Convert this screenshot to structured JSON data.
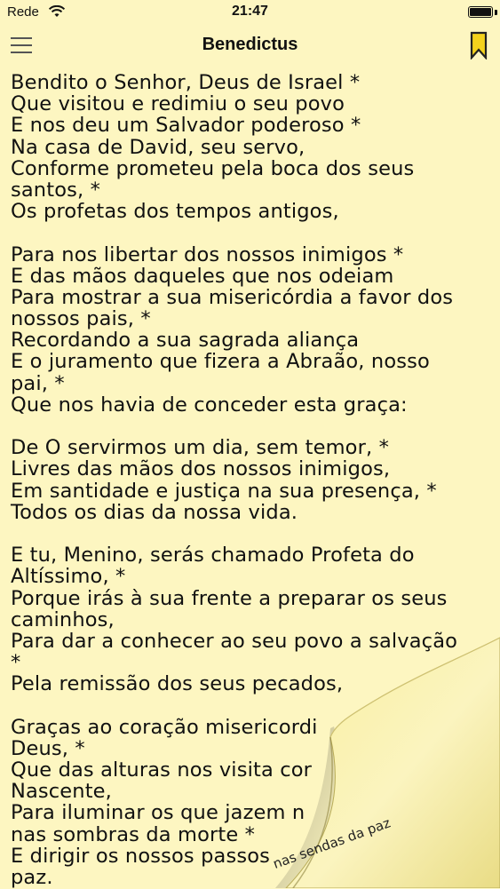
{
  "status_bar": {
    "carrier": "Rede",
    "time": "21:47"
  },
  "nav": {
    "title": "Benedictus"
  },
  "content": {
    "lines": [
      "Bendito o Senhor, Deus de Israel *",
      "Que visitou e redimiu o seu povo",
      "E nos deu um Salvador poderoso *",
      "Na casa de David, seu servo,",
      "Conforme prometeu pela boca dos seus",
      "santos, *",
      "Os profetas dos tempos antigos,",
      "",
      "Para nos libertar dos nossos inimigos *",
      "E das mãos daqueles que nos odeiam",
      "Para mostrar a sua misericórdia a favor dos",
      "nossos pais, *",
      "Recordando a sua sagrada aliança",
      "E o juramento que fizera a Abraão, nosso",
      "pai, *",
      "Que nos havia de conceder esta graça:",
      "",
      "De O servirmos um dia, sem temor, *",
      "Livres das mãos dos nossos inimigos,",
      "Em santidade e justiça na sua presença, *",
      "Todos os dias da nossa vida.",
      "",
      "E tu, Menino, serás chamado Profeta do",
      "Altíssimo, *",
      "Porque irás à sua frente a preparar os seus",
      "caminhos,",
      "Para dar a conhecer ao seu povo a salvação",
      "*",
      "Pela remissão dos seus pecados,",
      "",
      "Graças ao coração misericordi",
      "Deus, *",
      "Que das alturas nos visita cor",
      "Nascente,",
      "Para iluminar os que jazem n",
      "nas sombras da morte *",
      "E dirigir os nossos passos",
      "paz."
    ],
    "curl_text": "nas sendas da paz"
  },
  "colors": {
    "background": "#fdf6c1",
    "bookmark": "#f4d21d"
  }
}
